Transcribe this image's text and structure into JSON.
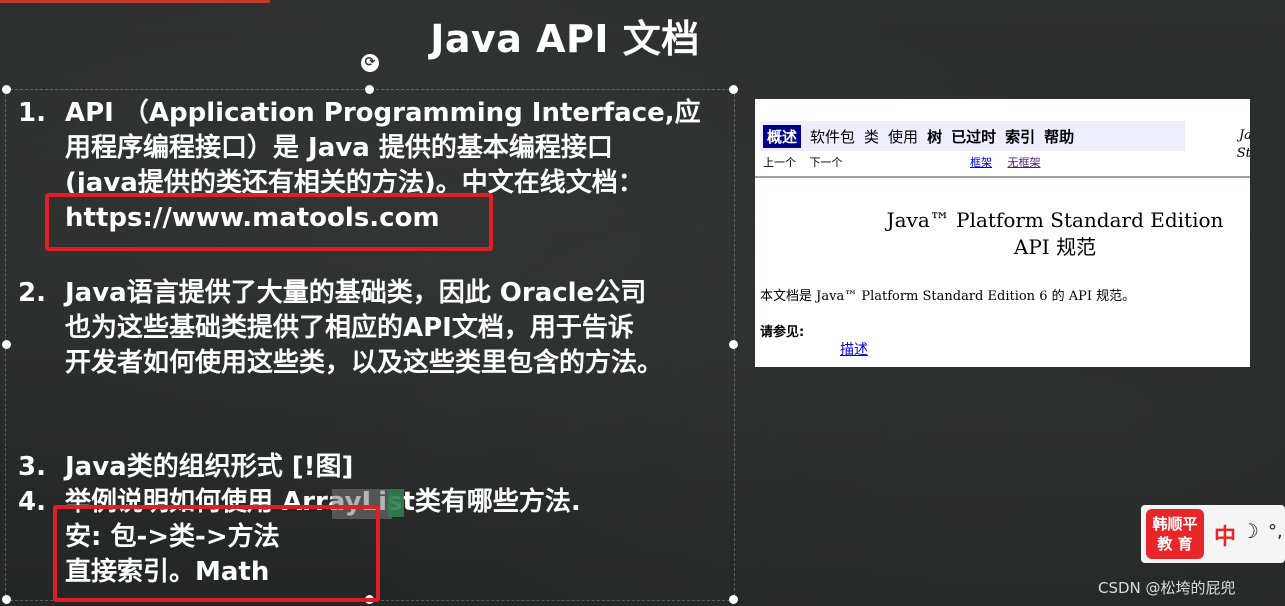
{
  "slide": {
    "title": "Java API 文档",
    "items": [
      {
        "number": "1.",
        "lines": [
          "API （Application Programming Interface,应",
          "用程序编程接口）是 Java 提供的基本编程接口",
          "(java提供的类还有相关的方法)。中文在线文档：",
          "https://www.matools.com"
        ]
      },
      {
        "number": "2.",
        "lines": [
          "Java语言提供了大量的基础类，因此 Oracle公司",
          "也为这些基础类提供了相应的API文档，用于告诉",
          "开发者如何使用这些类，以及这些类里包含的方法。"
        ]
      },
      {
        "number": "3.",
        "lines": [
          "Java类的组织形式 [!图]"
        ]
      },
      {
        "number": "4.",
        "lines": [
          "举例说明如何使用 ArrayList类有哪些方法.",
          "安: 包->类->方法",
          "直接索引。Math"
        ]
      }
    ]
  },
  "api_doc": {
    "nav": [
      "概述",
      "软件包",
      "类",
      "使用",
      "树",
      "已过时",
      "索引",
      "帮助"
    ],
    "active_nav": "概述",
    "subnav": [
      "上一个",
      "下一个"
    ],
    "frames_links": [
      "框架",
      "无框架"
    ],
    "side_text": [
      "Java",
      "Stan"
    ],
    "title_line1": "Java™ Platform Standard Edition",
    "title_line2": "API 规范",
    "description": "本文档是 Java™ Platform Standard Edition 6 的 API 规范。",
    "see_also": "请参见:",
    "see_also_link": "描述"
  },
  "brand": {
    "logo_line1": "韩顺平",
    "logo_line2": "教 育",
    "mid": "中",
    "moon": "☽",
    "dots": "°,"
  },
  "watermark": "CSDN @松垮的屁兜",
  "colors": {
    "highlight_box": "#e01e25",
    "nav_active": "#00008b",
    "brand_red": "#e8262a"
  }
}
